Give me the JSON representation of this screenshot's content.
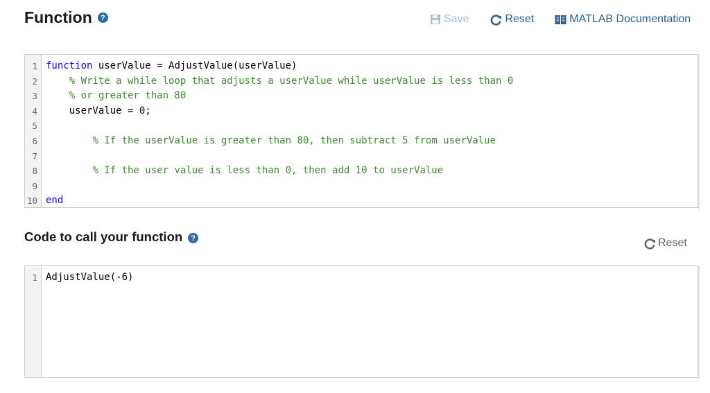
{
  "function_section": {
    "title": "Function",
    "help_icon": "question-circle-icon",
    "toolbar": {
      "save_label": "Save",
      "save_icon": "floppy-disk-icon",
      "reset_label": "Reset",
      "reset_icon": "refresh-icon",
      "docs_label": "MATLAB Documentation",
      "docs_icon": "book-icon"
    },
    "editor": {
      "line_numbers": [
        "1",
        "2",
        "3",
        "4",
        "5",
        "6",
        "7",
        "8",
        "9",
        "10"
      ],
      "lines": [
        {
          "indent": "",
          "keyword": "function",
          "text": " userValue = AdjustValue(userValue)",
          "comment": ""
        },
        {
          "indent": "    ",
          "keyword": "",
          "text": "",
          "comment": "% Write a while loop that adjusts a userValue while userValue is less than 0"
        },
        {
          "indent": "    ",
          "keyword": "",
          "text": "",
          "comment": "% or greater than 80"
        },
        {
          "indent": "    ",
          "keyword": "",
          "text": "userValue = 0;",
          "comment": ""
        },
        {
          "indent": "",
          "keyword": "",
          "text": "",
          "comment": ""
        },
        {
          "indent": "        ",
          "keyword": "",
          "text": "",
          "comment": "% If the userValue is greater than 80, then subtract 5 from userValue"
        },
        {
          "indent": "",
          "keyword": "",
          "text": "",
          "comment": ""
        },
        {
          "indent": "        ",
          "keyword": "",
          "text": "",
          "comment": "% If the user value is less than 0, then add 10 to userValue"
        },
        {
          "indent": "",
          "keyword": "",
          "text": "",
          "comment": ""
        },
        {
          "indent": "",
          "keyword": "end",
          "text": "",
          "comment": ""
        }
      ]
    }
  },
  "call_section": {
    "title": "Code to call your function",
    "help_icon": "question-circle-icon",
    "reset_label": "Reset",
    "reset_icon": "refresh-icon",
    "editor": {
      "line_numbers": [
        "1"
      ],
      "lines": [
        {
          "indent": "",
          "keyword": "",
          "text": "AdjustValue(-6)",
          "comment": ""
        }
      ]
    }
  },
  "colors": {
    "accent": "#2d5e8c",
    "help_icon": "#2d6da3",
    "save_disabled": "#a9bfd4",
    "keyword": "#0e00ff",
    "comment": "#3b8c2e"
  }
}
